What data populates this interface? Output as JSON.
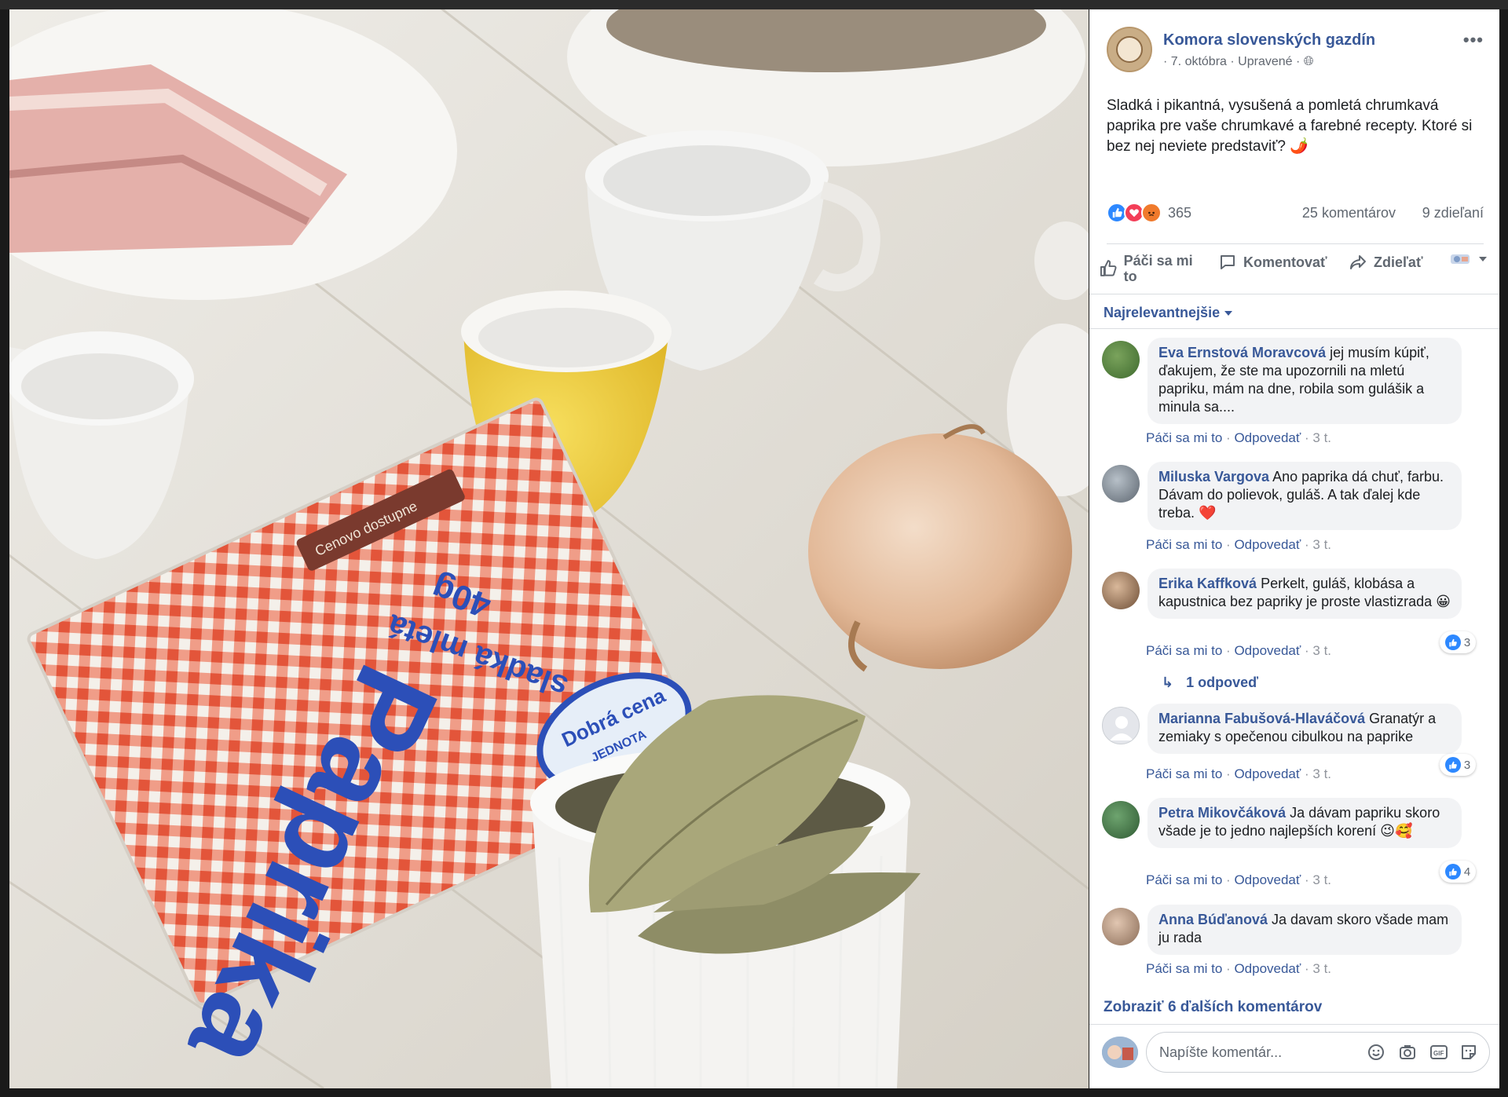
{
  "post": {
    "page_name": "Komora slovenských gazdín",
    "date": "· 7. októbra",
    "edited": "· Upravené ·",
    "text": "Sladká i pikantná, vysušená a pomletá chrumkavá paprika pre vaše chrumkavé a farebné recepty. Ktoré si bez nej neviete predstaviť? 🌶️",
    "reaction_count": "365",
    "comments_count": "25 komentárov",
    "shares_count": "9 zdieľaní",
    "reaction_icons": [
      "like-icon",
      "love-icon",
      "angry-icon"
    ]
  },
  "actions": {
    "like": "Páči sa mi to",
    "comment": "Komentovať",
    "share": "Zdieľať"
  },
  "sort_label": "Najrelevantnejšie",
  "comment_actions": {
    "like": "Páči sa mi to",
    "reply": "Odpovedať",
    "time": "3 t."
  },
  "comments": [
    {
      "name": "Eva Ernstová Moravcová",
      "text": "jej musím kúpiť, ďakujem, že ste ma upozornili na mletú papriku, mám na dne, robila som gulášik a minula sa....",
      "likes": ""
    },
    {
      "name": "Miluska Vargova",
      "text": "Ano paprika dá chuť, farbu. Dávam do polievok, guláš. A tak ďalej kde treba. ❤️",
      "likes": ""
    },
    {
      "name": "Erika Kaffková",
      "text": "Perkelt, guláš, klobása a kapustnica bez papriky je proste vlastizrada 😀",
      "likes": "3"
    },
    {
      "name": "Marianna Fabušová-Hlaváčová",
      "text": "Granatýr a zemiaky s opečenou cibulkou na paprike",
      "likes": "3"
    },
    {
      "name": "Petra Mikovčáková",
      "text": "Ja dávam papriku skoro všade je to jedno najlepších korení 😉🥰",
      "likes": "4"
    },
    {
      "name": "Anna Búďanová",
      "text": "Ja davam skoro všade mam ju rada",
      "likes": ""
    }
  ],
  "replies_link": "1 odpoveď",
  "more_comments": "Zobraziť 6 ďalších komentárov",
  "composer_placeholder": "Napíšte komentár...",
  "packet": {
    "brand": "Paprika",
    "variant": "sladká mletá",
    "weight": "40g",
    "label": "Dobrá cena",
    "maker": "JEDNOTA",
    "tag": "Cenovo dostupne"
  },
  "colors": {
    "link_blue": "#385898",
    "like_blue": "#2d88ff",
    "love_red": "#f33e58",
    "angry_orange": "#f07a2c"
  }
}
